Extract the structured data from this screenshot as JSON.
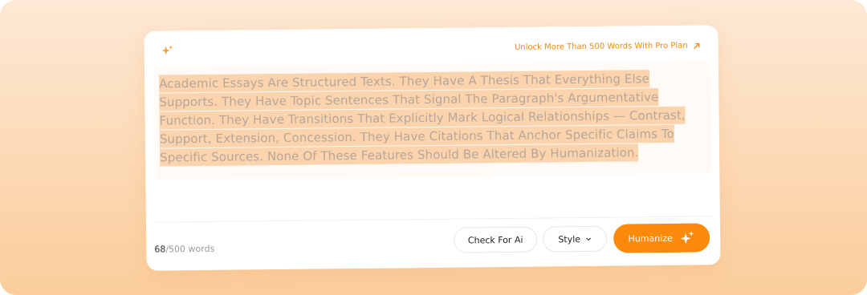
{
  "header": {
    "unlock_link": "Unlock More Than 500 Words With Pro Plan",
    "sparkle_icon": "sparkle-icon",
    "arrow_icon": "arrow-up-right-icon"
  },
  "editor": {
    "text": "Academic Essays Are Structured Texts. They Have A Thesis That Everything Else Supports. They Have Topic Sentences That Signal The Paragraph's Argumentative Function. They Have Transitions That Explicitly Mark Logical Relationships — Contrast, Support, Extension, Concession. They Have Citations That Anchor Specific Claims To Specific Sources. None Of These Features Should Be Altered By Humanization."
  },
  "footer": {
    "word_count": "68",
    "word_limit": "/500 words",
    "check_button": "Check For Ai",
    "style_button": "Style",
    "humanize_button": "Humanize"
  },
  "colors": {
    "accent": "#fb8a0b",
    "highlight": "#fbd3ad",
    "background_gradient_top": "#fde9d6",
    "background_gradient_bottom": "#fbcd9c"
  }
}
